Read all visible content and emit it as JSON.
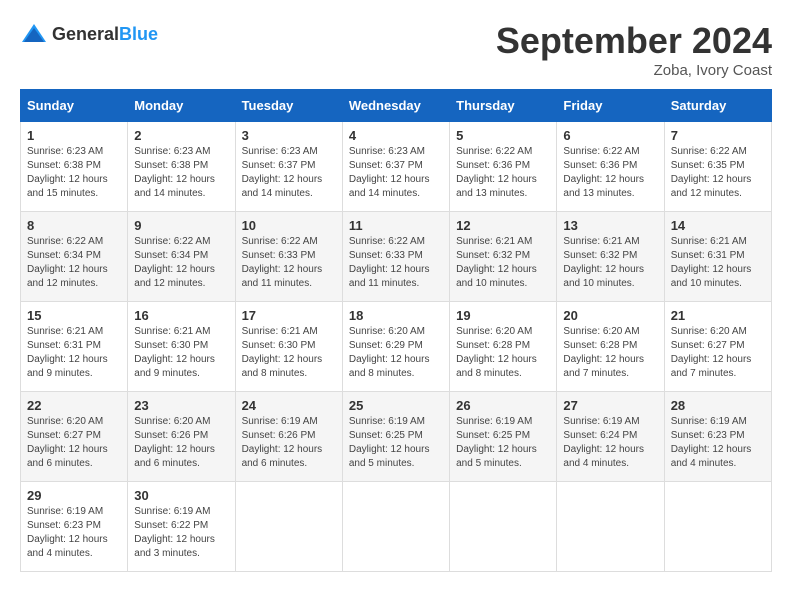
{
  "logo": {
    "general": "General",
    "blue": "Blue"
  },
  "title": "September 2024",
  "subtitle": "Zoba, Ivory Coast",
  "headers": [
    "Sunday",
    "Monday",
    "Tuesday",
    "Wednesday",
    "Thursday",
    "Friday",
    "Saturday"
  ],
  "weeks": [
    [
      {
        "day": "1",
        "sunrise": "6:23 AM",
        "sunset": "6:38 PM",
        "daylight": "12 hours and 15 minutes."
      },
      {
        "day": "2",
        "sunrise": "6:23 AM",
        "sunset": "6:38 PM",
        "daylight": "12 hours and 14 minutes."
      },
      {
        "day": "3",
        "sunrise": "6:23 AM",
        "sunset": "6:37 PM",
        "daylight": "12 hours and 14 minutes."
      },
      {
        "day": "4",
        "sunrise": "6:23 AM",
        "sunset": "6:37 PM",
        "daylight": "12 hours and 14 minutes."
      },
      {
        "day": "5",
        "sunrise": "6:22 AM",
        "sunset": "6:36 PM",
        "daylight": "12 hours and 13 minutes."
      },
      {
        "day": "6",
        "sunrise": "6:22 AM",
        "sunset": "6:36 PM",
        "daylight": "12 hours and 13 minutes."
      },
      {
        "day": "7",
        "sunrise": "6:22 AM",
        "sunset": "6:35 PM",
        "daylight": "12 hours and 12 minutes."
      }
    ],
    [
      {
        "day": "8",
        "sunrise": "6:22 AM",
        "sunset": "6:34 PM",
        "daylight": "12 hours and 12 minutes."
      },
      {
        "day": "9",
        "sunrise": "6:22 AM",
        "sunset": "6:34 PM",
        "daylight": "12 hours and 12 minutes."
      },
      {
        "day": "10",
        "sunrise": "6:22 AM",
        "sunset": "6:33 PM",
        "daylight": "12 hours and 11 minutes."
      },
      {
        "day": "11",
        "sunrise": "6:22 AM",
        "sunset": "6:33 PM",
        "daylight": "12 hours and 11 minutes."
      },
      {
        "day": "12",
        "sunrise": "6:21 AM",
        "sunset": "6:32 PM",
        "daylight": "12 hours and 10 minutes."
      },
      {
        "day": "13",
        "sunrise": "6:21 AM",
        "sunset": "6:32 PM",
        "daylight": "12 hours and 10 minutes."
      },
      {
        "day": "14",
        "sunrise": "6:21 AM",
        "sunset": "6:31 PM",
        "daylight": "12 hours and 10 minutes."
      }
    ],
    [
      {
        "day": "15",
        "sunrise": "6:21 AM",
        "sunset": "6:31 PM",
        "daylight": "12 hours and 9 minutes."
      },
      {
        "day": "16",
        "sunrise": "6:21 AM",
        "sunset": "6:30 PM",
        "daylight": "12 hours and 9 minutes."
      },
      {
        "day": "17",
        "sunrise": "6:21 AM",
        "sunset": "6:30 PM",
        "daylight": "12 hours and 8 minutes."
      },
      {
        "day": "18",
        "sunrise": "6:20 AM",
        "sunset": "6:29 PM",
        "daylight": "12 hours and 8 minutes."
      },
      {
        "day": "19",
        "sunrise": "6:20 AM",
        "sunset": "6:28 PM",
        "daylight": "12 hours and 8 minutes."
      },
      {
        "day": "20",
        "sunrise": "6:20 AM",
        "sunset": "6:28 PM",
        "daylight": "12 hours and 7 minutes."
      },
      {
        "day": "21",
        "sunrise": "6:20 AM",
        "sunset": "6:27 PM",
        "daylight": "12 hours and 7 minutes."
      }
    ],
    [
      {
        "day": "22",
        "sunrise": "6:20 AM",
        "sunset": "6:27 PM",
        "daylight": "12 hours and 6 minutes."
      },
      {
        "day": "23",
        "sunrise": "6:20 AM",
        "sunset": "6:26 PM",
        "daylight": "12 hours and 6 minutes."
      },
      {
        "day": "24",
        "sunrise": "6:19 AM",
        "sunset": "6:26 PM",
        "daylight": "12 hours and 6 minutes."
      },
      {
        "day": "25",
        "sunrise": "6:19 AM",
        "sunset": "6:25 PM",
        "daylight": "12 hours and 5 minutes."
      },
      {
        "day": "26",
        "sunrise": "6:19 AM",
        "sunset": "6:25 PM",
        "daylight": "12 hours and 5 minutes."
      },
      {
        "day": "27",
        "sunrise": "6:19 AM",
        "sunset": "6:24 PM",
        "daylight": "12 hours and 4 minutes."
      },
      {
        "day": "28",
        "sunrise": "6:19 AM",
        "sunset": "6:23 PM",
        "daylight": "12 hours and 4 minutes."
      }
    ],
    [
      {
        "day": "29",
        "sunrise": "6:19 AM",
        "sunset": "6:23 PM",
        "daylight": "12 hours and 4 minutes."
      },
      {
        "day": "30",
        "sunrise": "6:19 AM",
        "sunset": "6:22 PM",
        "daylight": "12 hours and 3 minutes."
      },
      null,
      null,
      null,
      null,
      null
    ]
  ],
  "labels": {
    "sunrise": "Sunrise:",
    "sunset": "Sunset:",
    "daylight": "Daylight:"
  }
}
